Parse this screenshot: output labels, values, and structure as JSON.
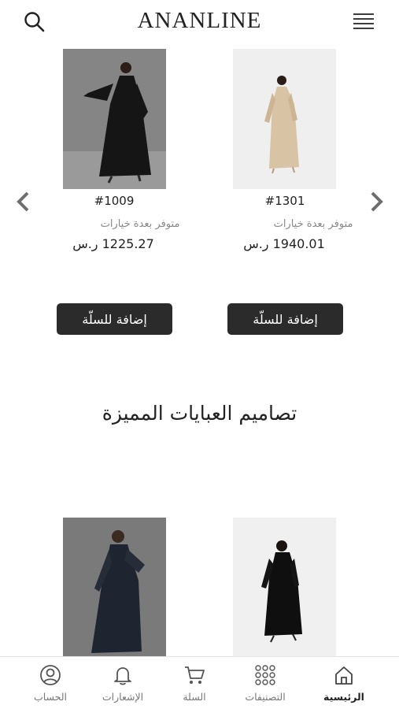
{
  "header": {
    "brand": "ANANLINE",
    "search_icon": "search-icon",
    "menu_icon": "menu-icon"
  },
  "carousel": {
    "prev_icon": "chevron-left-icon",
    "next_icon": "chevron-right-icon",
    "products": [
      {
        "code": "#1301",
        "availability": "متوفر بعدة خيارات",
        "price": "1940.01 ر.س",
        "add_label": "إضافة للسلّة",
        "image_color": "#d9c3a5"
      },
      {
        "code": "#1009",
        "availability": "متوفر بعدة خيارات",
        "price": "1225.27 ر.س",
        "add_label": "إضافة للسلّة",
        "image_color": "#141414"
      }
    ]
  },
  "featured": {
    "title": "تصاميم العبايات المميزة",
    "products": [
      {
        "image_color": "#111111"
      },
      {
        "image_color": "#1f2530"
      }
    ]
  },
  "bottom_nav": {
    "items": [
      {
        "label": "الرئيسية",
        "icon": "home-icon",
        "active": true
      },
      {
        "label": "التصنيفات",
        "icon": "grid-dots-icon",
        "active": false
      },
      {
        "label": "السلة",
        "icon": "cart-icon",
        "active": false
      },
      {
        "label": "الإشعارات",
        "icon": "bell-icon",
        "active": false
      },
      {
        "label": "الحساب",
        "icon": "user-circle-icon",
        "active": false
      }
    ]
  },
  "colors": {
    "button_bg": "#2b2b2b",
    "text_primary": "#222222",
    "text_muted": "#888888"
  }
}
